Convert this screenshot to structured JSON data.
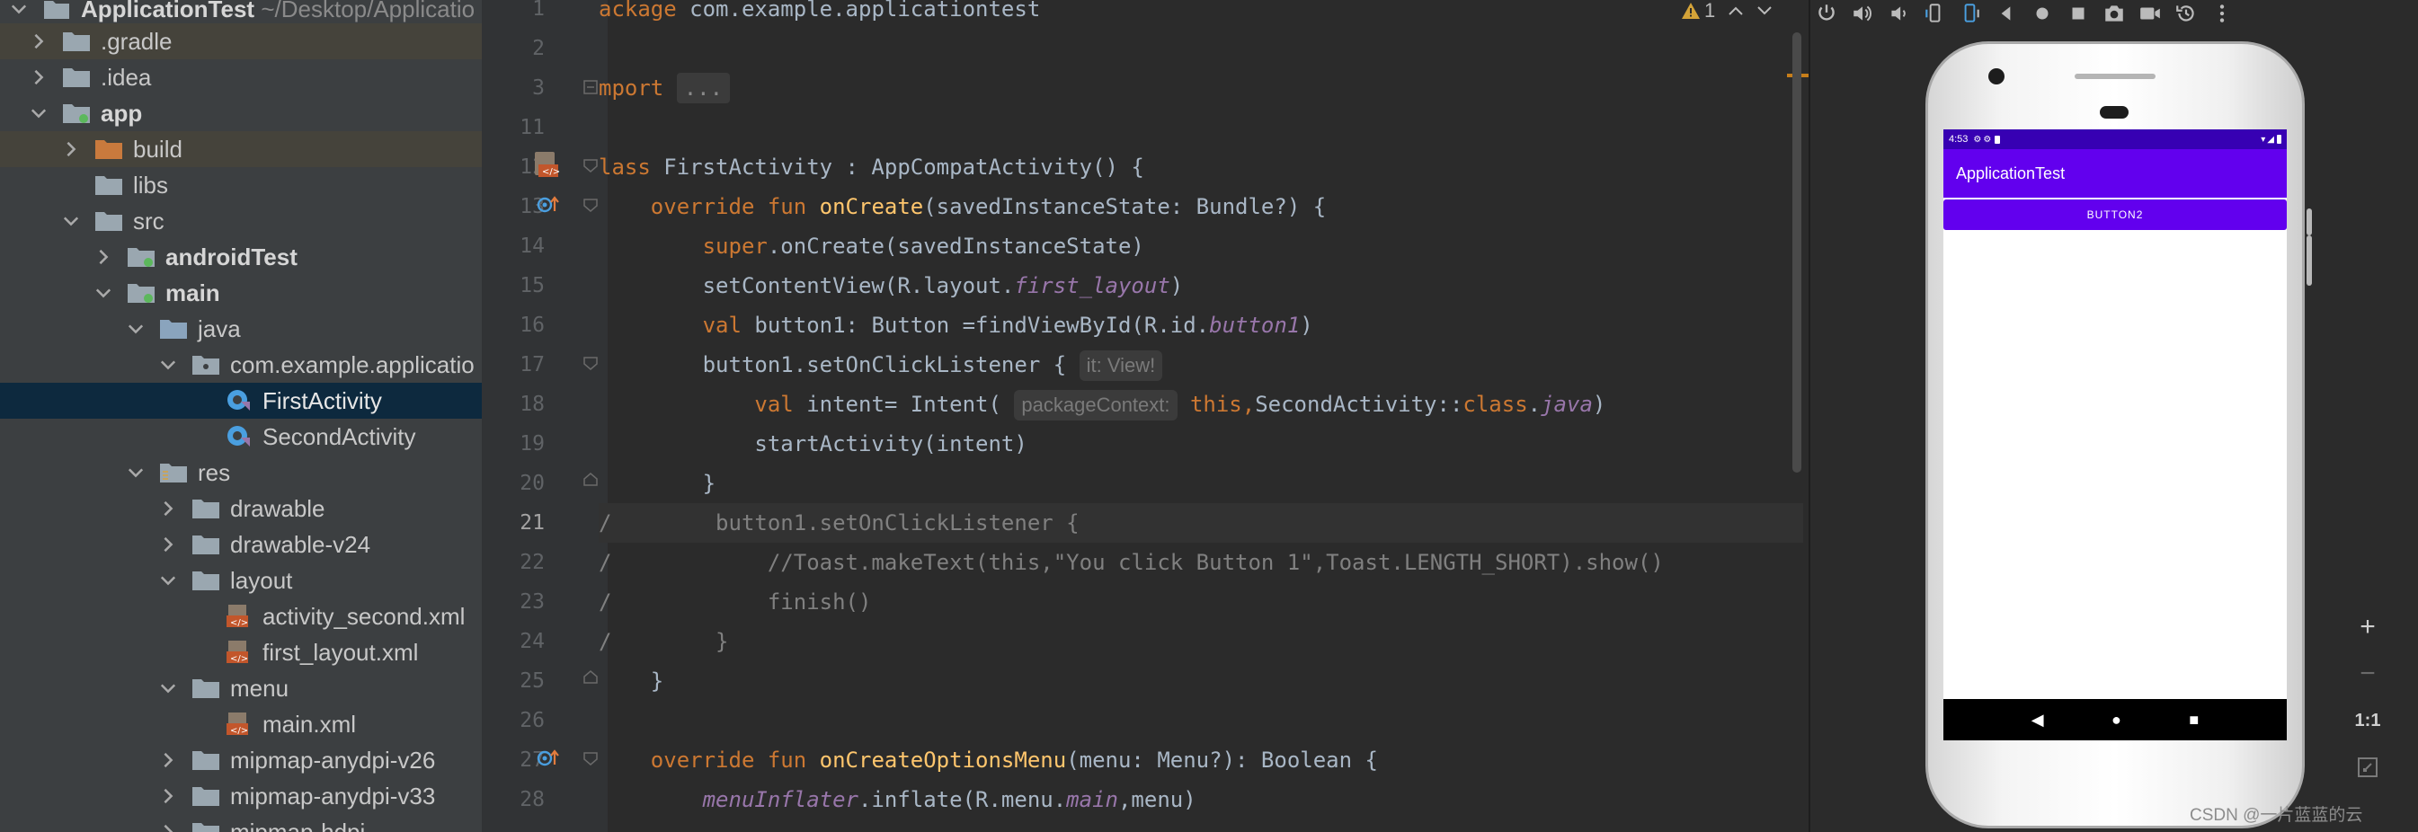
{
  "project_tree": {
    "root": {
      "label": "ApplicationTest",
      "path": "~/Desktop/Applicatio"
    },
    "rows": [
      {
        "label": ".gradle",
        "depth": 0,
        "expanded": false
      },
      {
        "label": ".idea",
        "depth": 0,
        "expanded": false
      },
      {
        "label": "app",
        "depth": 0,
        "expanded": true
      },
      {
        "label": "build",
        "depth": 1,
        "expanded": false
      },
      {
        "label": "libs",
        "depth": 1
      },
      {
        "label": "src",
        "depth": 1,
        "expanded": true
      },
      {
        "label": "androidTest",
        "depth": 2,
        "expanded": false
      },
      {
        "label": "main",
        "depth": 2,
        "expanded": true
      },
      {
        "label": "java",
        "depth": 3,
        "expanded": true
      },
      {
        "label": "com.example.applicatio",
        "depth": 4,
        "expanded": true
      },
      {
        "label": "FirstActivity",
        "depth": 5
      },
      {
        "label": "SecondActivity",
        "depth": 5
      },
      {
        "label": "res",
        "depth": 3,
        "expanded": true
      },
      {
        "label": "drawable",
        "depth": 4,
        "expanded": false
      },
      {
        "label": "drawable-v24",
        "depth": 4,
        "expanded": false
      },
      {
        "label": "layout",
        "depth": 4,
        "expanded": true
      },
      {
        "label": "activity_second.xml",
        "depth": 5
      },
      {
        "label": "first_layout.xml",
        "depth": 5
      },
      {
        "label": "menu",
        "depth": 4,
        "expanded": true
      },
      {
        "label": "main.xml",
        "depth": 5
      },
      {
        "label": "mipmap-anydpi-v26",
        "depth": 4,
        "expanded": false
      },
      {
        "label": "mipmap-anydpi-v33",
        "depth": 4,
        "expanded": false
      },
      {
        "label": "mipmap-hdpi",
        "depth": 4,
        "expanded": false
      }
    ]
  },
  "editor": {
    "warning_count": "1",
    "line_numbers": [
      "1",
      "2",
      "3",
      "11",
      "12",
      "13",
      "14",
      "15",
      "16",
      "17",
      "18",
      "19",
      "20",
      "21",
      "22",
      "23",
      "24",
      "25",
      "26",
      "27",
      "28"
    ],
    "current_line": "21",
    "lines": {
      "l1_kw": "ackage",
      "l1_rest": " com.example.applicationtest",
      "l3_kw": "mport",
      "l3_ell": "...",
      "l12_kw": "lass",
      "l12_rest": " FirstActivity : AppCompatActivity() {",
      "l13_kw": "    override fun ",
      "l13_fn": "onCreate",
      "l13_rest": "(savedInstanceState: Bundle?) {",
      "l14_kw": "        super",
      "l14_rest": ".onCreate(savedInstanceState)",
      "l15_pre": "        setContentView(R.layout.",
      "l15_it": "first_layout",
      "l15_post": ")",
      "l16_kw": "        val",
      "l16_pre": " button1: Button =findViewById(R.id.",
      "l16_it": "button1",
      "l16_post": ")",
      "l17_pre": "        button1.setOnClickListener { ",
      "l17_hint": "it: View!",
      "l18_kw": "            val",
      "l18_pre": " intent= Intent( ",
      "l18_hint": "packageContext:",
      "l18_this": " this,",
      "l18_mid": "SecondActivity::",
      "l18_class": "class",
      "l18_dot": ".",
      "l18_java": "java",
      "l18_post": ")",
      "l19": "            startActivity(intent)",
      "l20": "        }",
      "l21": "/        button1.setOnClickListener {",
      "l22": "/            //Toast.makeText(this,\"You click Button 1\",Toast.LENGTH_SHORT).show()",
      "l23": "/            finish()",
      "l24": "/        }",
      "l25": "    }",
      "l27_kw": "    override fun ",
      "l27_fn": "onCreateOptionsMenu",
      "l27_rest": "(menu: Menu?): Boolean {",
      "l28_it": "        menuInflater",
      "l28_pre": ".inflate(R.menu.",
      "l28_it2": "main",
      "l28_post": ",menu)"
    }
  },
  "emulator": {
    "status_time": "4:53",
    "app_title": "ApplicationTest",
    "button_label": "BUTTON2",
    "zoom_in": "+",
    "zoom_out": "−",
    "zoom_reset": "1:1"
  },
  "watermark": "CSDN @一片蓝蓝的云",
  "colors": {
    "primary": "#6200ee",
    "primary_dark": "#3700b3",
    "keyword": "#cc7832",
    "function": "#ffc66d"
  }
}
